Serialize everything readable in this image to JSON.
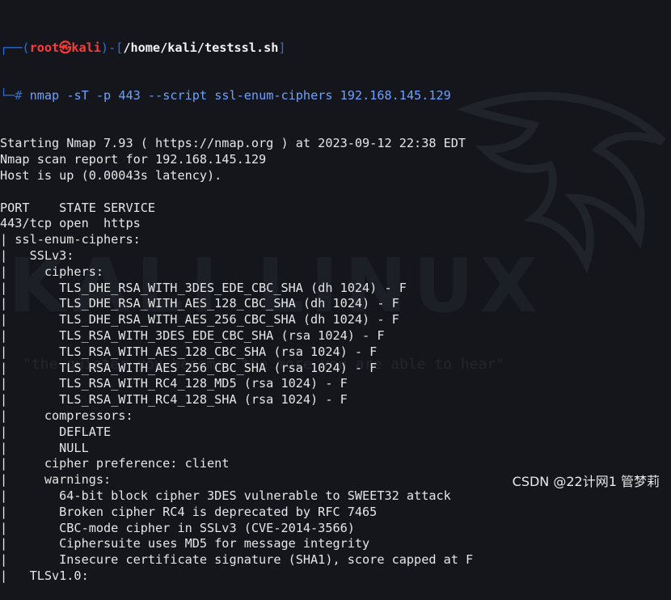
{
  "prompt": {
    "corner_top": "┌──(",
    "user": "root",
    "at": "㉿",
    "host": "kali",
    "sep": ")-[",
    "path": "/home/kali/testssl.sh",
    "close": "]",
    "corner_bottom": "└─",
    "hash": "#",
    "command": "nmap",
    "args": " -sT -p 443 --script ssl-enum-ciphers 192.168.145.129"
  },
  "output_lines": [
    "Starting Nmap 7.93 ( https://nmap.org ) at 2023-09-12 22:38 EDT",
    "Nmap scan report for 192.168.145.129",
    "Host is up (0.00043s latency).",
    "",
    "PORT    STATE SERVICE",
    "443/tcp open  https",
    "| ssl-enum-ciphers:",
    "|   SSLv3:",
    "|     ciphers:",
    "|       TLS_DHE_RSA_WITH_3DES_EDE_CBC_SHA (dh 1024) - F",
    "|       TLS_DHE_RSA_WITH_AES_128_CBC_SHA (dh 1024) - F",
    "|       TLS_DHE_RSA_WITH_AES_256_CBC_SHA (dh 1024) - F",
    "|       TLS_RSA_WITH_3DES_EDE_CBC_SHA (rsa 1024) - F",
    "|       TLS_RSA_WITH_AES_128_CBC_SHA (rsa 1024) - F",
    "|       TLS_RSA_WITH_AES_256_CBC_SHA (rsa 1024) - F",
    "|       TLS_RSA_WITH_RC4_128_MD5 (rsa 1024) - F",
    "|       TLS_RSA_WITH_RC4_128_SHA (rsa 1024) - F",
    "|     compressors:",
    "|       DEFLATE",
    "|       NULL",
    "|     cipher preference: client",
    "|     warnings:",
    "|       64-bit block cipher 3DES vulnerable to SWEET32 attack",
    "|       Broken cipher RC4 is deprecated by RFC 7465",
    "|       CBC-mode cipher in SSLv3 (CVE-2014-3566)",
    "|       Ciphersuite uses MD5 for message integrity",
    "|       Insecure certificate signature (SHA1), score capped at F",
    "|   TLSv1.0:"
  ],
  "background": {
    "logo_text": "KALI LINUX",
    "tagline": "\"the quieter you become, the more you are able to hear\""
  },
  "watermark": "CSDN @22计网1 管梦莉",
  "colors": {
    "background": "#14161b",
    "prompt_frame": "#2b6fe0",
    "user_host": "#ff3b3b",
    "command": "#6fa0ff",
    "text": "#e6e6e6"
  }
}
